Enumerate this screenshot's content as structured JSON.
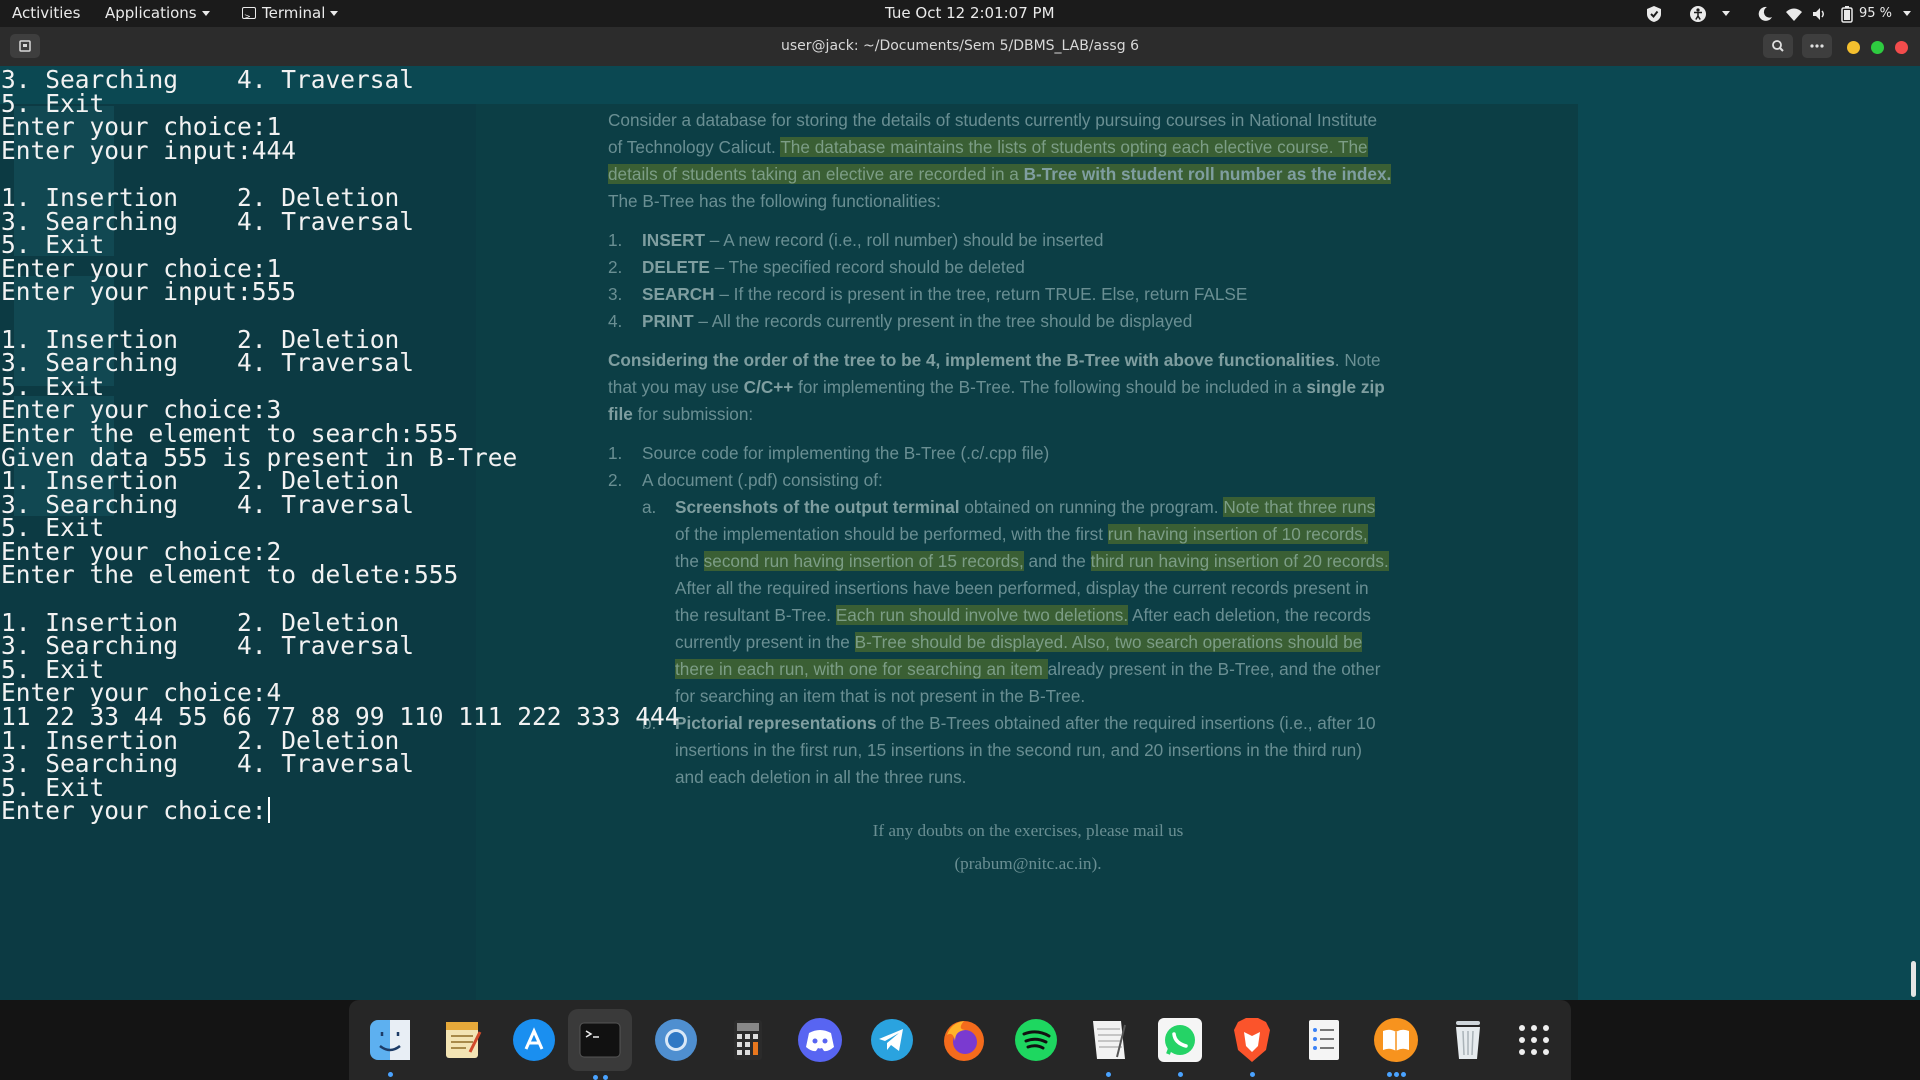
{
  "topbar": {
    "activities": "Activities",
    "applications": "Applications",
    "terminal_menu": "Terminal",
    "clock": "Tue Oct 12  2:01:07 PM",
    "battery": "95 %"
  },
  "window": {
    "title": "user@jack: ~/Documents/Sem 5/DBMS_LAB/assg 6"
  },
  "terminal": {
    "lines": [
      "3. Searching    4. Traversal",
      "5. Exit",
      "Enter your choice:1",
      "Enter your input:444",
      "",
      "1. Insertion    2. Deletion",
      "3. Searching    4. Traversal",
      "5. Exit",
      "Enter your choice:1",
      "Enter your input:555",
      "",
      "1. Insertion    2. Deletion",
      "3. Searching    4. Traversal",
      "5. Exit",
      "Enter your choice:3",
      "Enter the element to search:555",
      "Given data 555 is present in B-Tree",
      "1. Insertion    2. Deletion",
      "3. Searching    4. Traversal",
      "5. Exit",
      "Enter your choice:2",
      "Enter the element to delete:555",
      "",
      "1. Insertion    2. Deletion",
      "3. Searching    4. Traversal",
      "5. Exit",
      "Enter your choice:4",
      "11 22 33 44 55 66 77 88 99 110 111 222 333 444",
      "1. Insertion    2. Deletion",
      "3. Searching    4. Traversal",
      "5. Exit"
    ],
    "prompt": "Enter your choice:"
  },
  "doc": {
    "intro_1": "Consider a database for storing the details of students currently pursuing courses in National Institute",
    "intro_2a": "of Technology Calicut. ",
    "intro_2b": "The database maintains the lists of students opting each elective course.  The",
    "intro_3a": "details of students taking an elective are recorded in a ",
    "intro_3b": "B-Tree with student roll number as the index.",
    "intro_4": "The B-Tree has the following functionalities:",
    "funcs": [
      {
        "num": "1.",
        "name": "INSERT",
        "desc": " – A new record (i.e., roll number) should be inserted"
      },
      {
        "num": "2.",
        "name": "DELETE",
        "desc": " – The specified record should be deleted"
      },
      {
        "num": "3.",
        "name": "SEARCH",
        "desc": " – If the record is present in the tree, return TRUE. Else, return FALSE"
      },
      {
        "num": "4.",
        "name": "PRINT",
        "desc": " – All the records currently present in the tree should be displayed"
      }
    ],
    "order_bold": "Considering the order of the tree to be 4, implement the B-Tree with above functionalities",
    "order_rest": ". Note",
    "order_2a": "that you may use ",
    "order_2b": "C/C++",
    "order_2c": " for implementing the B-Tree.  The following should be included in a ",
    "order_2d": "single zip",
    "order_3a": "file",
    "order_3b": " for submission:",
    "sub_1": "Source code for implementing the B-Tree (.c/.cpp file)",
    "sub_2": "A document (.pdf) consisting of:",
    "a_bold": "Screenshots of the output terminal",
    "a_1": " obtained on running the program. ",
    "a_1h": "Note that three runs",
    "a_2a": "of the implementation should be performed, with the first ",
    "a_2b": "run having insertion of 10 records,",
    "a_3a": "the ",
    "a_3b": "second run having insertion of 15 records,",
    "a_3c": " and the ",
    "a_3d": "third run having insertion of 20 records.",
    "a_4": "After all the required insertions have been performed, display the current records present in",
    "a_5a": "the resultant B-Tree. ",
    "a_5b": "Each run should involve two deletions.",
    "a_5c": " After each deletion, the records",
    "a_6a": "currently present in the ",
    "a_6b": "B-Tree should be displayed. Also, two search operations should be",
    "a_7a": "there in each run, with one for searching an item ",
    "a_7b": "already present in the B-Tree, and the other",
    "a_8": "for searching an item that is not present in the B-Tree.",
    "b_bold": "Pictorial representations",
    "b_1": " of the B-Trees obtained after the required insertions (i.e., after 10",
    "b_2": "insertions in the first run, 15 insertions in the second run, and 20 insertions in the third run)",
    "b_3": "and each deletion in all the three runs.",
    "footer_1": "If any doubts on the exercises, please mail us",
    "footer_2": "(prabum@nitc.ac.in)."
  },
  "dock": {
    "apps": [
      "finder-icon",
      "text-editor-icon",
      "app-store-icon",
      "terminal-icon",
      "chromium-icon",
      "calculator-icon",
      "discord-icon",
      "telegram-icon",
      "firefox-icon",
      "spotify-icon",
      "notes-icon",
      "whatsapp-icon",
      "brave-icon",
      "todo-list-icon",
      "books-icon",
      "trash-icon",
      "app-grid-icon"
    ]
  }
}
